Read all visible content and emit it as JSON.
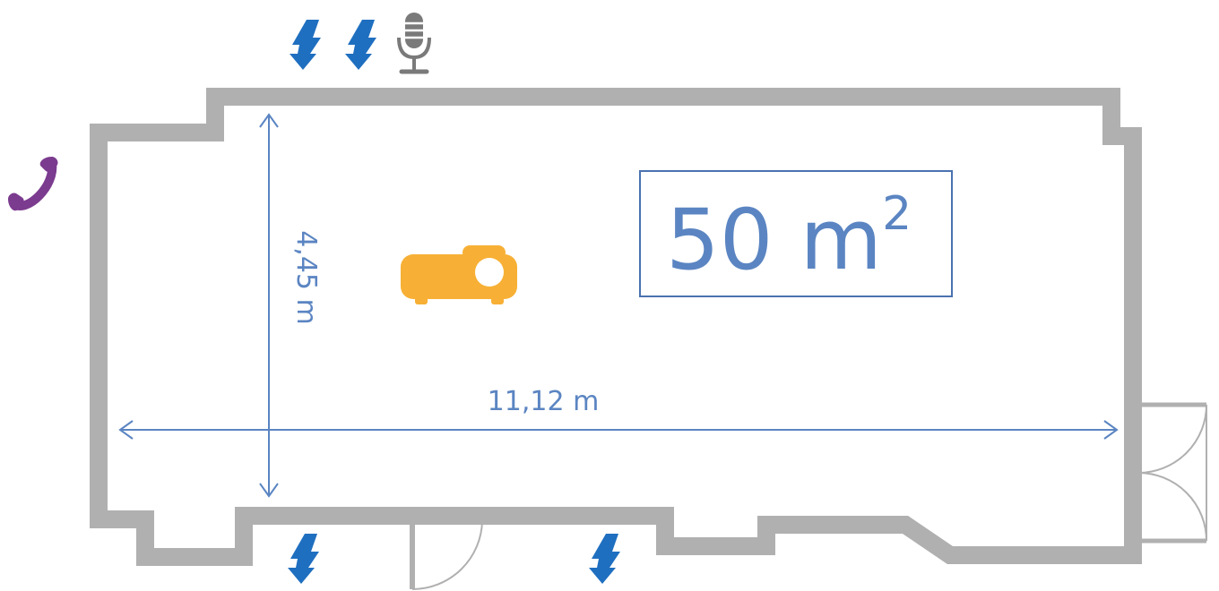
{
  "room": {
    "area_value": "50 m",
    "area_superscript": "2",
    "width_label": "11,12 m",
    "depth_label": "4,45 m"
  },
  "icons": {
    "power_outlet": "lightning-bolt",
    "microphone": "microphone",
    "phone": "telephone",
    "projector": "projector"
  },
  "colors": {
    "wall": "#b0b0b0",
    "dimension": "#5b85c2",
    "power": "#1f6fc0",
    "microphone": "#7a7a7a",
    "phone": "#7b3b8f",
    "projector": "#f7b035"
  }
}
